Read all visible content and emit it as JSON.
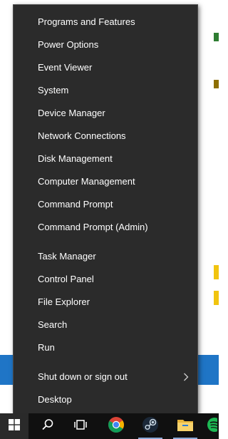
{
  "menu": {
    "items": [
      {
        "label": "Programs and Features"
      },
      {
        "label": "Power Options"
      },
      {
        "label": "Event Viewer"
      },
      {
        "label": "System"
      },
      {
        "label": "Device Manager"
      },
      {
        "label": "Network Connections"
      },
      {
        "label": "Disk Management"
      },
      {
        "label": "Computer Management"
      },
      {
        "label": "Command Prompt"
      },
      {
        "label": "Command Prompt (Admin)"
      },
      {
        "label": "Task Manager"
      },
      {
        "label": "Control Panel"
      },
      {
        "label": "File Explorer"
      },
      {
        "label": "Search"
      },
      {
        "label": "Run"
      },
      {
        "label": "Shut down or sign out",
        "has_submenu": true
      },
      {
        "label": "Desktop"
      }
    ]
  },
  "taskbar": {
    "buttons": [
      {
        "icon": "windows-logo-icon"
      },
      {
        "icon": "search-icon"
      },
      {
        "icon": "task-view-icon"
      },
      {
        "icon": "chrome-icon"
      },
      {
        "icon": "steam-icon"
      },
      {
        "icon": "file-explorer-icon"
      },
      {
        "icon": "app-icon"
      }
    ]
  },
  "colors": {
    "menu_bg": "#2b2b2b",
    "menu_text": "#ffffff",
    "taskbar_bg": "#101010",
    "accent_blue": "#1f75c6"
  }
}
